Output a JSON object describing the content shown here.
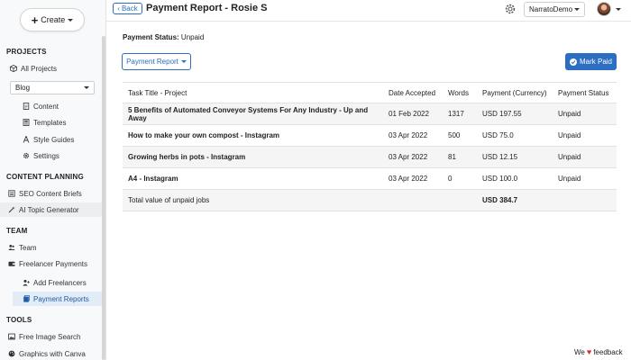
{
  "sidebar": {
    "create_label": "Create",
    "sections": {
      "projects": "PROJECTS",
      "content_planning": "CONTENT PLANNING",
      "team": "TEAM",
      "tools": "TOOLS"
    },
    "all_projects": "All Projects",
    "project_select": "Blog",
    "content": "Content",
    "templates": "Templates",
    "style_guides": "Style Guides",
    "settings": "Settings",
    "seo_briefs": "SEO Content Briefs",
    "ai_topic": "AI Topic Generator",
    "team": "Team",
    "freelancer_payments": "Freelancer Payments",
    "add_freelancers": "Add Freelancers",
    "payment_reports": "Payment Reports",
    "free_image_search": "Free Image Search",
    "graphics_canva": "Graphics with Canva"
  },
  "header": {
    "back_label": "Back",
    "title": "Payment Report - Rosie S",
    "org_name": "NarratoDemo"
  },
  "main": {
    "status_label": "Payment Status:",
    "status_value": "Unpaid",
    "report_dropdown": "Payment Report",
    "mark_paid": "Mark Paid"
  },
  "table": {
    "headers": [
      "Task Title - Project",
      "Date Accepted",
      "Words",
      "Payment (Currency)",
      "Payment Status"
    ],
    "rows": [
      {
        "title": "5 Benefits of Automated Conveyor Systems For Any Industry - Up and Away",
        "date": "01 Feb 2022",
        "words": "1317",
        "payment": "USD 197.55",
        "status": "Unpaid"
      },
      {
        "title": "How to make your own compost - Instagram",
        "date": "03 Apr 2022",
        "words": "500",
        "payment": "USD 75.0",
        "status": "Unpaid"
      },
      {
        "title": "Growing herbs in pots - Instagram",
        "date": "03 Apr 2022",
        "words": "81",
        "payment": "USD 12.15",
        "status": "Unpaid"
      },
      {
        "title": "A4 - Instagram",
        "date": "03 Apr 2022",
        "words": "0",
        "payment": "USD 100.0",
        "status": "Unpaid"
      }
    ],
    "total_label": "Total value of unpaid jobs",
    "total_value": "USD 384.7"
  },
  "footer": {
    "feedback_pre": "We",
    "feedback_post": "feedback"
  },
  "colors": {
    "accent": "#2c6fc2",
    "active_bg": "#e1ecf7",
    "heart": "#d9302c"
  }
}
